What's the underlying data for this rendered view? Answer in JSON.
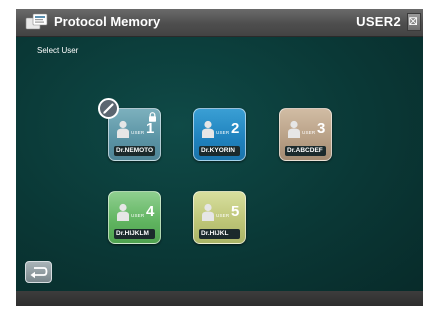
{
  "header": {
    "title": "Protocol Memory",
    "current_user": "USER2",
    "close_icon": "close-icon",
    "app_icon": "protocol-memory-icon"
  },
  "main": {
    "section_label": "Select User",
    "users": [
      {
        "user_word": "USER",
        "number": "1",
        "name": "Dr.NEMOTO",
        "color": "#5a93a4",
        "locked": true
      },
      {
        "user_word": "USER",
        "number": "2",
        "name": "Dr.KYORIN",
        "color": "#1f81bd"
      },
      {
        "user_word": "USER",
        "number": "3",
        "name": "Dr.ABCDEF",
        "color": "#b79f85"
      },
      {
        "user_word": "USER",
        "number": "4",
        "name": "Dr.HIJKLM",
        "color": "#5fb35f"
      },
      {
        "user_word": "USER",
        "number": "5",
        "name": "Dr.HIJKL",
        "color": "#bcc476"
      }
    ],
    "edit_icon": "pencil-icon",
    "lock_icon": "lock-icon",
    "back_icon": "return-arrow-icon"
  },
  "colors": {
    "background": "#0a3836",
    "titlebar": "#4e4e4e",
    "text": "#ffffff"
  }
}
